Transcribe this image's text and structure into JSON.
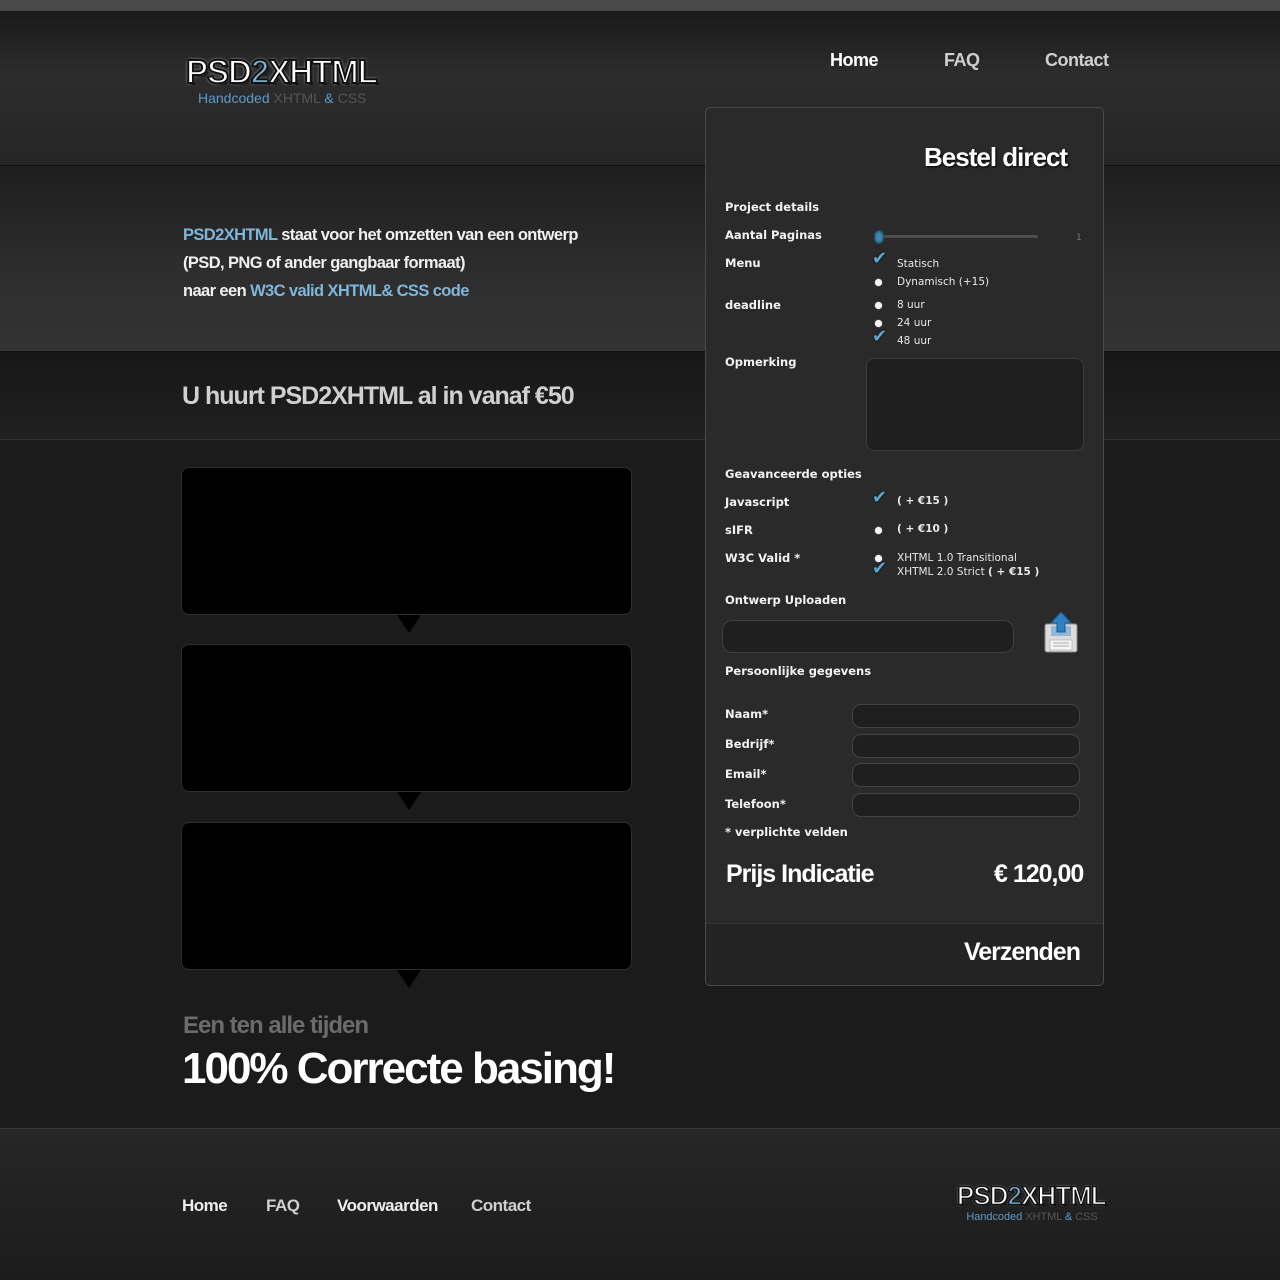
{
  "header": {
    "logo": {
      "part1": "PSD",
      "part2": "2",
      "part3": "XHTML",
      "tag_1": "Handcoded ",
      "tag_2": "XHTML ",
      "tag_3": "& ",
      "tag_4": "CSS"
    },
    "nav": [
      "Home",
      "FAQ",
      "Contact"
    ]
  },
  "hero": {
    "line1_hl": "PSD2XHTML",
    "line1_rest": " staat voor het omzetten van een ontwerp",
    "line2": "(PSD, PNG of ander gangbaar formaat)",
    "line3_pre": "naar een ",
    "line3_hl": "W3C valid XHTML& CSS code"
  },
  "price_headline": "U huurt PSD2XHTML al in vanaf €50",
  "slogan": {
    "sub": "Een ten alle tijden",
    "main": "100% Correcte basing!"
  },
  "footer": {
    "nav": [
      "Home",
      "FAQ",
      "Voorwaarden",
      "Contact"
    ]
  },
  "order": {
    "title": "Bestel direct",
    "project_details": "Project details",
    "pages_label": "Aantal Paginas",
    "pages_value": "1",
    "pages_fraction": 0.0,
    "menu_label": "Menu",
    "menu_options": [
      "Statisch",
      "Dynamisch (+15)"
    ],
    "menu_selected": "Statisch",
    "deadline_label": "deadline",
    "deadline_options": [
      "8 uur",
      "24 uur",
      "48 uur"
    ],
    "deadline_selected": "48 uur",
    "remark_label": "Opmerking",
    "advanced_label": "Geavanceerde opties",
    "javascript_label": "Javascript",
    "javascript_price": "( + €15 )",
    "javascript_checked": true,
    "sifr_label": "sIFR",
    "sifr_price": "( + €10 )",
    "sifr_checked": false,
    "w3c_label": "W3C Valid *",
    "w3c_opt1": "XHTML 1.0 Transitional",
    "w3c_opt2": "XHTML 2.0 Strict ",
    "w3c_opt2_price": "( + €15 )",
    "upload_label": "Ontwerp Uploaden",
    "personal_label": "Persoonlijke gegevens",
    "fields": [
      "Naam*",
      "Bedrijf*",
      "Email*",
      "Telefoon*"
    ],
    "required_note": "* verplichte velden",
    "price_label": "Prijs Indicatie",
    "price_value": "€ 120,00",
    "submit": "Verzenden"
  },
  "colors": {
    "accent": "#7fb6d8",
    "checkmark": "#56a7d4",
    "panel": "#2a2a2b",
    "background": "#1c1b1c"
  }
}
